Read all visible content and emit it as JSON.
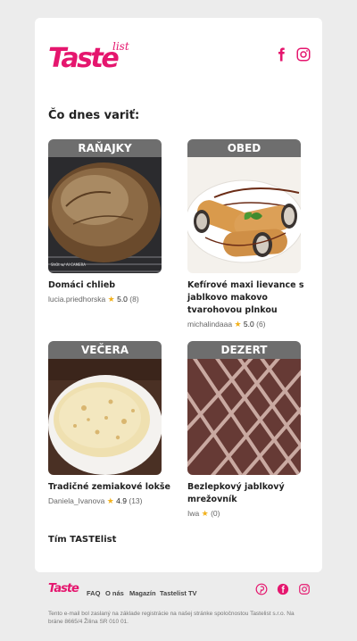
{
  "brand": {
    "logo_main": "Taste",
    "logo_sub": "list",
    "accent_color": "#e5166e"
  },
  "header": {
    "social": [
      {
        "name": "facebook-icon"
      },
      {
        "name": "instagram-icon"
      }
    ]
  },
  "heading": "Čo dnes variť:",
  "recipes": [
    {
      "category": "RAŇAJKY",
      "title": "Domáci chlieb",
      "author": "lucia.priedhorska",
      "rating": "5.0",
      "count": "(8)"
    },
    {
      "category": "OBED",
      "title": "Kefírové maxi lievance s jablkovo makovo tvarohovou plnkou",
      "author": "michalindaaa",
      "rating": "5.0",
      "count": "(6)"
    },
    {
      "category": "VEČERA",
      "title": "Tradičné zemiakové lokše",
      "author": "Daniela_Ivanova",
      "rating": "4.9",
      "count": "(13)"
    },
    {
      "category": "DEZERT",
      "title": "Bezlepkový jablkový mrežovník",
      "author": "Iwa",
      "rating": "",
      "count": "(0)"
    }
  ],
  "signoff": "Tím TASTElist",
  "footer": {
    "logo": "Taste",
    "nav": [
      "FAQ",
      "O nás",
      "Magazín",
      "Tastelist TV"
    ],
    "social": [
      "pinterest-icon",
      "facebook-icon",
      "instagram-icon"
    ],
    "legal": "Tento e-mail bol zaslaný na základe registrácie na našej stránke spoločnostou Tastelist s.r.o. Na bráne 8665/4 Žilina SR 010 01."
  }
}
